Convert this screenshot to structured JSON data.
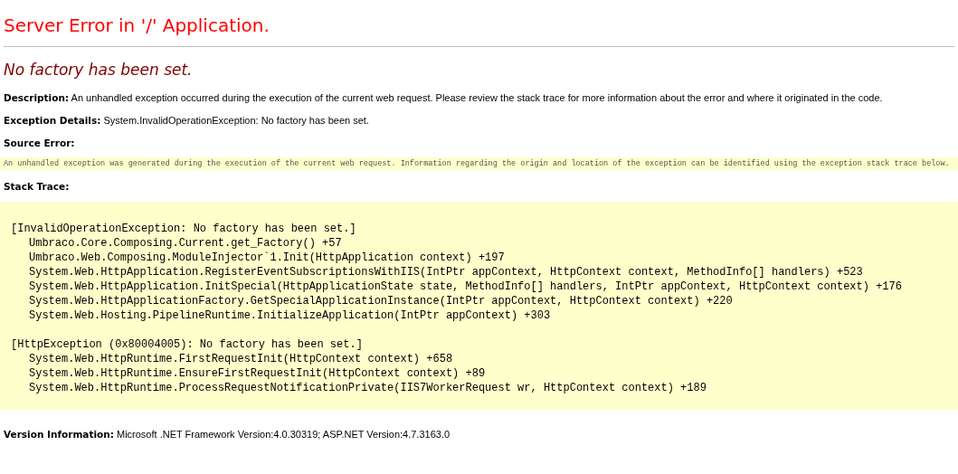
{
  "title": "Server Error in '/' Application.",
  "error_message": "No factory has been set.",
  "description": "**Description:** An unhandled exception occurred during the execution of the current web request. Please review the stack trace for more information about the error and where it originated in the code.",
  "exception_details": "**Exception Details:** System.InvalidOperationException: No factory has been set.",
  "source_error_heading": "Source Error:",
  "source_error_text": "An unhandled exception was generated during the execution of the current web request. Information regarding the origin and location of the exception can be identified using the exception stack trace below.",
  "stack_trace_heading": "Stack Trace:",
  "stack_trace": [
    {
      "header": "[InvalidOperationException: No factory has been set.]",
      "frames": [
        "Umbraco.Core.Composing.Current.get_Factory() +57",
        "Umbraco.Web.Composing.ModuleInjector`1.Init(HttpApplication context) +197",
        "System.Web.HttpApplication.RegisterEventSubscriptionsWithIIS(IntPtr appContext, HttpContext context, MethodInfo[] handlers) +523",
        "System.Web.HttpApplication.InitSpecial(HttpApplicationState state, MethodInfo[] handlers, IntPtr appContext, HttpContext context) +176",
        "System.Web.HttpApplicationFactory.GetSpecialApplicationInstance(IntPtr appContext, HttpContext context) +220",
        "System.Web.Hosting.PipelineRuntime.InitializeApplication(IntPtr appContext) +303"
      ]
    },
    {
      "header": "[HttpException (0x80004005): No factory has been set.]",
      "frames": [
        "System.Web.HttpRuntime.FirstRequestInit(HttpContext context) +658",
        "System.Web.HttpRuntime.EnsureFirstRequestInit(HttpContext context) +89",
        "System.Web.HttpRuntime.ProcessRequestNotificationPrivate(IIS7WorkerRequest wr, HttpContext context) +189"
      ]
    }
  ],
  "version_information": "**Version Information:** Microsoft .NET Framework Version:4.0.30319; ASP.NET Version:4.7.3163.0"
}
